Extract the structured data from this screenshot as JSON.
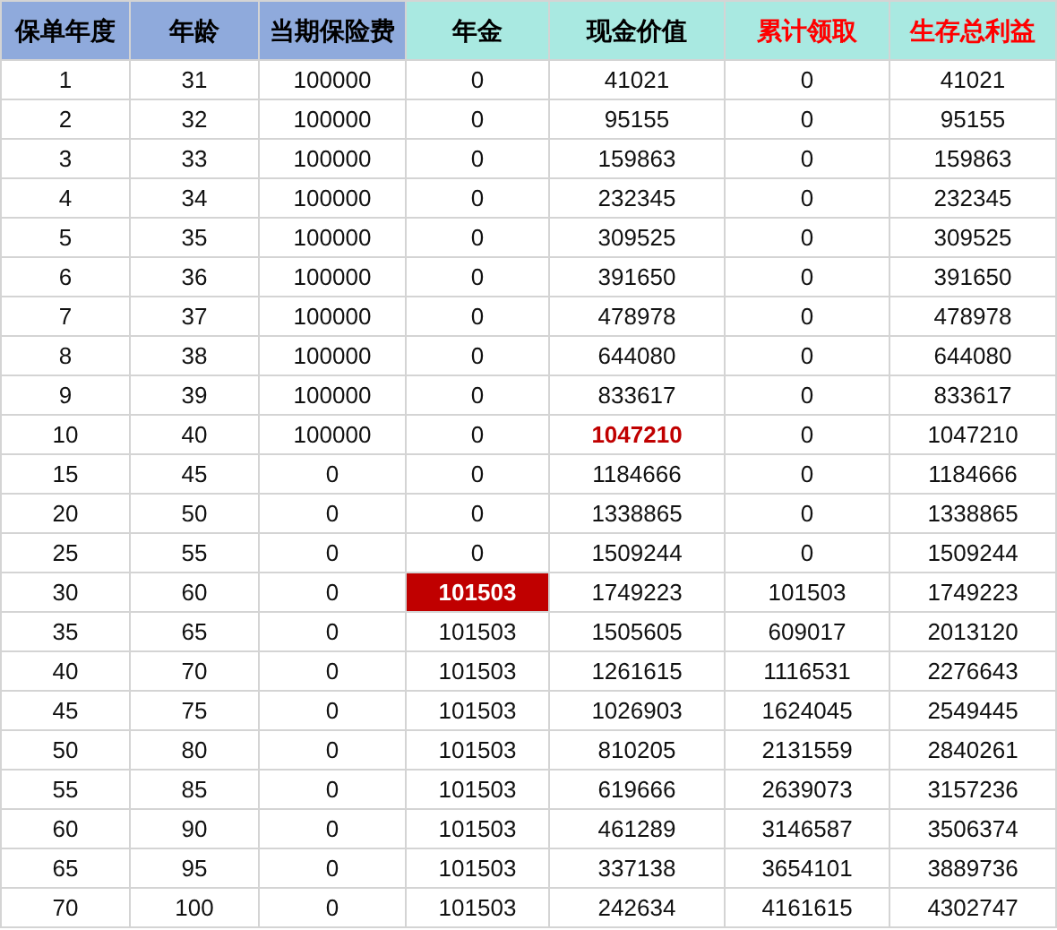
{
  "table": {
    "columns": [
      {
        "label": "保单年度",
        "kind": "input"
      },
      {
        "label": "年龄",
        "kind": "input"
      },
      {
        "label": "当期保险费",
        "kind": "input"
      },
      {
        "label": "年金",
        "kind": "output"
      },
      {
        "label": "现金价值",
        "kind": "output"
      },
      {
        "label": "累计领取",
        "kind": "emphasis"
      },
      {
        "label": "生存总利益",
        "kind": "emphasis"
      }
    ],
    "rows": [
      [
        "1",
        "31",
        "100000",
        "0",
        "41021",
        "0",
        "41021"
      ],
      [
        "2",
        "32",
        "100000",
        "0",
        "95155",
        "0",
        "95155"
      ],
      [
        "3",
        "33",
        "100000",
        "0",
        "159863",
        "0",
        "159863"
      ],
      [
        "4",
        "34",
        "100000",
        "0",
        "232345",
        "0",
        "232345"
      ],
      [
        "5",
        "35",
        "100000",
        "0",
        "309525",
        "0",
        "309525"
      ],
      [
        "6",
        "36",
        "100000",
        "0",
        "391650",
        "0",
        "391650"
      ],
      [
        "7",
        "37",
        "100000",
        "0",
        "478978",
        "0",
        "478978"
      ],
      [
        "8",
        "38",
        "100000",
        "0",
        "644080",
        "0",
        "644080"
      ],
      [
        "9",
        "39",
        "100000",
        "0",
        "833617",
        "0",
        "833617"
      ],
      [
        "10",
        "40",
        "100000",
        "0",
        {
          "text": "1047210",
          "kind": "red_text"
        },
        "0",
        "1047210"
      ],
      [
        "15",
        "45",
        "0",
        "0",
        "1184666",
        "0",
        "1184666"
      ],
      [
        "20",
        "50",
        "0",
        "0",
        "1338865",
        "0",
        "1338865"
      ],
      [
        "25",
        "55",
        "0",
        "0",
        "1509244",
        "0",
        "1509244"
      ],
      [
        "30",
        "60",
        "0",
        {
          "text": "101503",
          "kind": "red_fill"
        },
        "1749223",
        "101503",
        "1749223"
      ],
      [
        "35",
        "65",
        "0",
        "101503",
        "1505605",
        "609017",
        "2013120"
      ],
      [
        "40",
        "70",
        "0",
        "101503",
        "1261615",
        "1116531",
        "2276643"
      ],
      [
        "45",
        "75",
        "0",
        "101503",
        "1026903",
        "1624045",
        "2549445"
      ],
      [
        "50",
        "80",
        "0",
        "101503",
        "810205",
        "2131559",
        "2840261"
      ],
      [
        "55",
        "85",
        "0",
        "101503",
        "619666",
        "2639073",
        "3157236"
      ],
      [
        "60",
        "90",
        "0",
        "101503",
        "461289",
        "3146587",
        "3506374"
      ],
      [
        "65",
        "95",
        "0",
        "101503",
        "337138",
        "3654101",
        "3889736"
      ],
      [
        "70",
        "100",
        "0",
        "101503",
        "242634",
        "4161615",
        "4302747"
      ]
    ]
  }
}
